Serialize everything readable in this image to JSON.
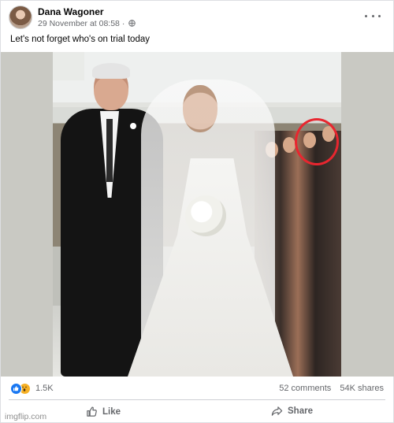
{
  "post": {
    "author": "Dana Wagoner",
    "date": "29 November at 08:58",
    "privacy_icon": "globe-icon",
    "menu_icon": "more-options-icon",
    "text": "Let's not forget who's on trial today"
  },
  "image": {
    "highlight_color": "#e8262f"
  },
  "engagement": {
    "reactions_count": "1.5K",
    "reaction_icons": [
      "like-icon",
      "wow-icon"
    ],
    "comments": "52 comments",
    "shares": "54K shares"
  },
  "actions": {
    "like_label": "Like",
    "share_label": "Share"
  },
  "watermark": "imgflip.com",
  "colors": {
    "facebook_blue": "#1877f2",
    "wow_yellow": "#f7b125",
    "secondary_text": "#65676b"
  }
}
